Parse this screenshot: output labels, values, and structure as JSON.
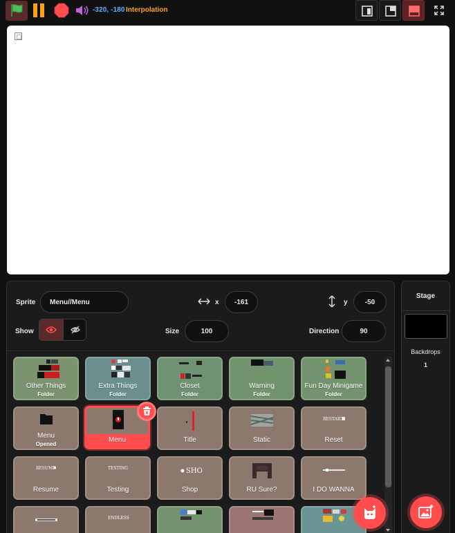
{
  "toolbar": {
    "coords": "-320, -180",
    "interpolation": "Interpolation",
    "icons": {
      "green_flag": "green-flag-icon",
      "pause": "pause-icon",
      "stop": "stop-icon",
      "audio": "speaker-icon",
      "small_stage": "small-stage-icon",
      "normal_stage": "normal-stage-icon",
      "large_stage": "large-stage-icon",
      "fullscreen": "fullscreen-icon"
    },
    "colors": {
      "flag": "#4cbf56",
      "pause": "#f7a21c",
      "stop": "#ff4c4c",
      "coords": "#5ab0ff",
      "interpolation": "#ffa21f",
      "accent": "#ff4c4c"
    }
  },
  "sprite_info": {
    "sprite_label": "Sprite",
    "sprite_name": "Menu//Menu",
    "x_label": "x",
    "x_value": "-161",
    "y_label": "y",
    "y_value": "-50",
    "show_label": "Show",
    "size_label": "Size",
    "size_value": "100",
    "direction_label": "Direction",
    "direction_value": "90"
  },
  "sprites": [
    {
      "name": "Other Things",
      "sub": "Folder",
      "color": "#7b936f"
    },
    {
      "name": "Extra Things",
      "sub": "Folder",
      "color": "#6b8f8f"
    },
    {
      "name": "Closet",
      "sub": "Folder",
      "color": "#6f9372"
    },
    {
      "name": "Warning",
      "sub": "Folder",
      "color": "#71936d"
    },
    {
      "name": "Fun Day Minigame",
      "sub": "Folder",
      "color": "#72936d"
    },
    {
      "name": "Menu",
      "sub": "Opened",
      "color": "#8c786c"
    },
    {
      "name": "Menu",
      "sub": "",
      "color": "#8c786c",
      "selected": true
    },
    {
      "name": "Title",
      "sub": "",
      "color": "#8c786c"
    },
    {
      "name": "Static",
      "sub": "",
      "color": "#8c786c"
    },
    {
      "name": "Reset",
      "sub": "",
      "color": "#8c786c"
    },
    {
      "name": "Resume",
      "sub": "",
      "color": "#8c786c"
    },
    {
      "name": "Testing",
      "sub": "",
      "color": "#8c786c"
    },
    {
      "name": "Shop",
      "sub": "",
      "color": "#8c786c"
    },
    {
      "name": "RU Sure?",
      "sub": "",
      "color": "#8c786c"
    },
    {
      "name": "I DO WANNA",
      "sub": "",
      "color": "#8c786c"
    }
  ],
  "thumb_text": {
    "reset": "RESTART",
    "resume": "RESUME",
    "testing": "TESTING",
    "shop": "SHO",
    "endless": "ENDLESS"
  },
  "stage_pane": {
    "title": "Stage",
    "backdrops_label": "Backdrops",
    "backdrops_count": "1"
  }
}
